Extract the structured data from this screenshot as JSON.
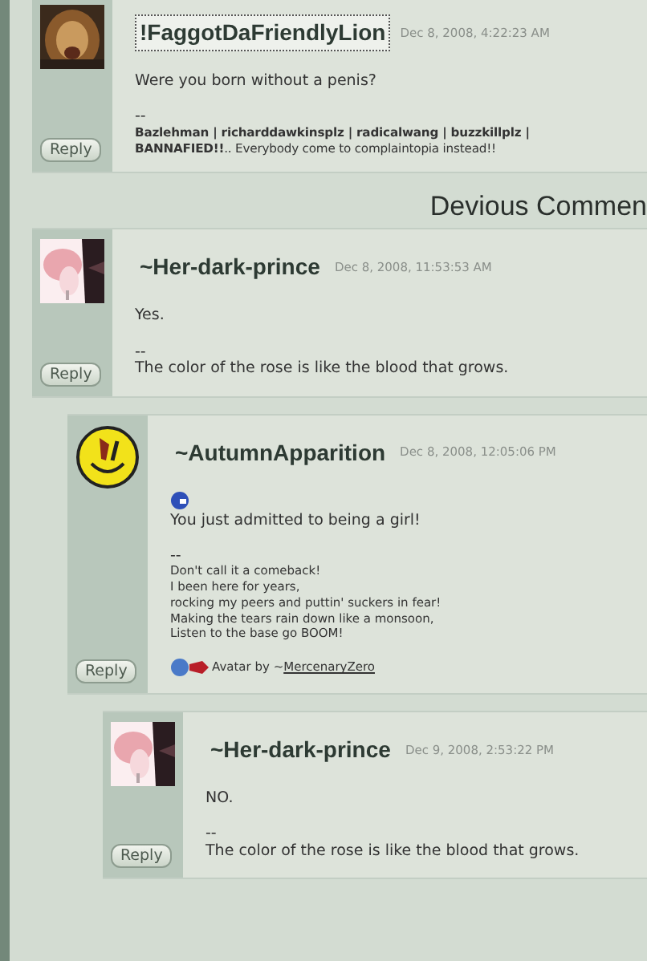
{
  "previous_comment": {
    "username": "!FaggotDaFriendlyLion",
    "focused": true,
    "date": "Dec 8, 2008, 4:22:23 AM",
    "avatar": {
      "kind": "picture"
    },
    "message": [
      {
        "kind": "text",
        "text": "Were you born without a penis?"
      }
    ],
    "separator": "--",
    "signature": [
      "**Bazlehman | richarddawkinsplz | radicalwang | buzzkillplz |**",
      "**BANNAFIED!!**.. Everybody come to complaintopia instead!!"
    ],
    "reply": "Reply"
  },
  "heading": "Devious Commen",
  "comments": [
    {
      "username": "~Her-dark-prince",
      "focused": false,
      "date": "Dec 8, 2008, 11:53:53 AM",
      "avatar": {
        "kind": "picture"
      },
      "message": [
        {
          "kind": "text",
          "text": "Yes."
        }
      ],
      "separator": "--",
      "signature": [
        "The color of the rose is like the blood that grows."
      ],
      "reply": "Reply",
      "children": [
        {
          "username": "~AutumnApparition",
          "focused": false,
          "date": "Dec 8, 2008, 12:05:06 PM",
          "avatar": {
            "kind": "icon"
          },
          "message": [
            {
              "kind": "emoticon"
            },
            {
              "kind": "text",
              "text": "You just admitted to being a girl!"
            }
          ],
          "separator": "--",
          "signature": [
            "Don't call it a comeback!",
            "I been here for years,",
            "rocking my peers and puttin' suckers in fear!",
            "Making the tears rain down like a monsoon,",
            "Listen to the base go BOOM!"
          ],
          "credit": {
            "text": "Avatar by ~",
            "link": "MercenaryZero"
          },
          "reply": "Reply",
          "children": [
            {
              "username": "~Her-dark-prince",
              "focused": false,
              "date": "Dec 9, 2008, 2:53:22 PM",
              "avatar": {
                "kind": "picture"
              },
              "message": [
                {
                  "kind": "text",
                  "text": "NO."
                }
              ],
              "separator": "--",
              "signature": [
                "The color of the rose is like the blood that grows."
              ],
              "reply": "Reply"
            }
          ]
        }
      ]
    }
  ]
}
